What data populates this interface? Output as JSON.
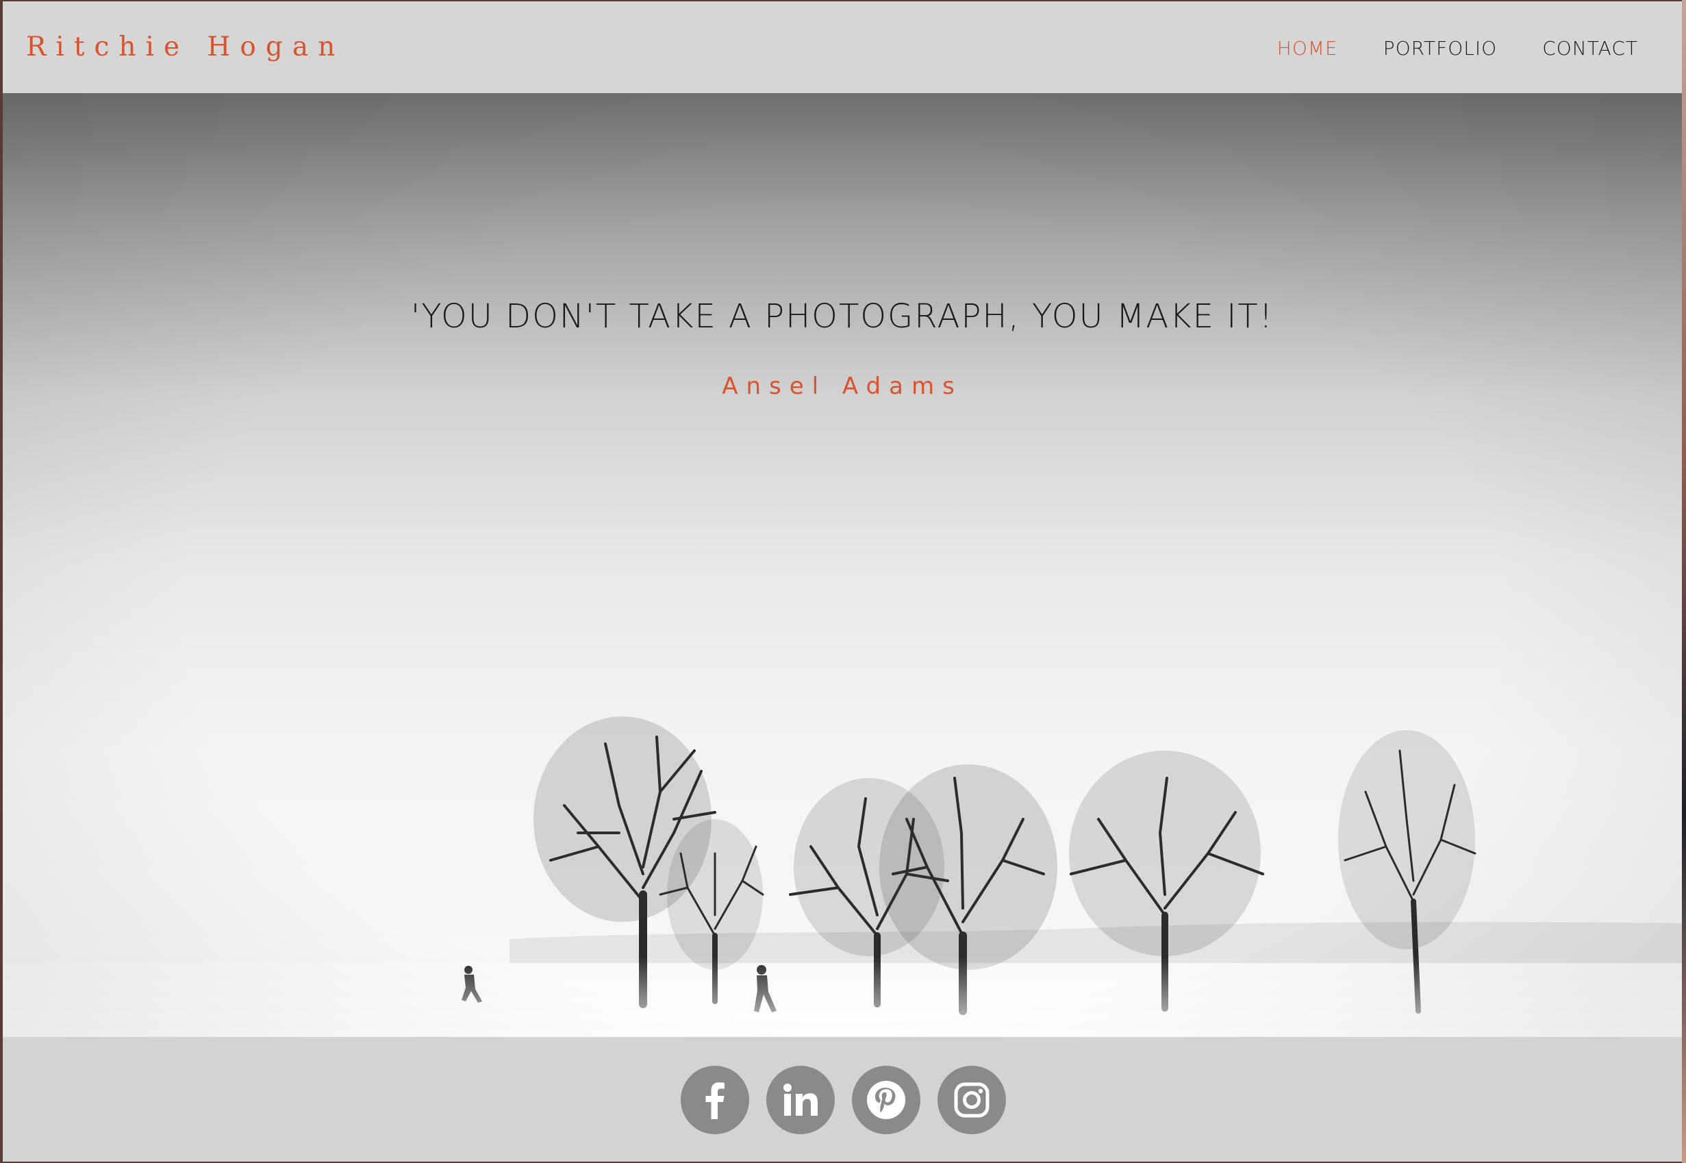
{
  "header": {
    "logo": "Ritchie Hogan",
    "nav": [
      "HOME",
      "PORTFOLIO",
      "CONTACT"
    ],
    "active_nav": "HOME"
  },
  "hero": {
    "quote": "'YOU DON'T TAKE A PHOTOGRAPH, YOU MAKE IT!",
    "author": "Ansel Adams"
  },
  "footer": {
    "socials": [
      "facebook-icon",
      "linkedin-icon",
      "pinterest-icon",
      "instagram-icon"
    ]
  },
  "colors": {
    "accent": "#d9532f",
    "bar_bg": "#d6d6d6",
    "icon_bg": "#8a8a8a"
  }
}
